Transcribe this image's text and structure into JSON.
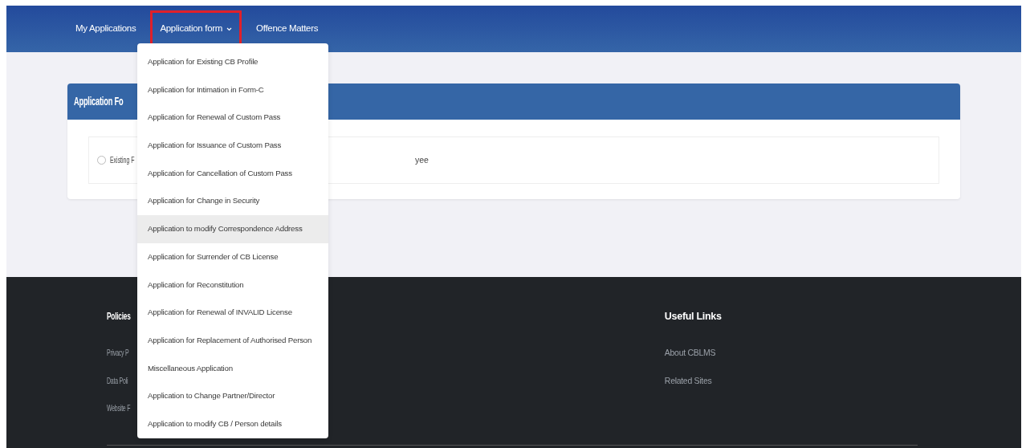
{
  "nav": {
    "items": [
      {
        "label": "My Applications",
        "kind": "link",
        "annotated": false
      },
      {
        "label": "Application form",
        "kind": "dropdown",
        "annotated": true,
        "expanded": true
      },
      {
        "label": "Offence Matters",
        "kind": "link",
        "annotated": false
      }
    ]
  },
  "dropdown_menu": {
    "items": [
      {
        "label": "Application for Existing CB Profile",
        "highlighted": false
      },
      {
        "label": "Application for Intimation in Form-C",
        "highlighted": false
      },
      {
        "label": "Application for Renewal of Custom Pass",
        "highlighted": false
      },
      {
        "label": "Application for Issuance of Custom Pass",
        "highlighted": false
      },
      {
        "label": "Application for Cancellation of Custom Pass",
        "highlighted": false
      },
      {
        "label": "Application for Change in Security",
        "highlighted": false
      },
      {
        "label": "Application to modify Correspondence Address",
        "highlighted": true
      },
      {
        "label": "Application for Surrender of CB License",
        "highlighted": false
      },
      {
        "label": "Application for Reconstitution",
        "highlighted": false
      },
      {
        "label": "Application for Renewal of INVALID License",
        "highlighted": false
      },
      {
        "label": "Application for Replacement of Authorised Person",
        "highlighted": false
      },
      {
        "label": "Miscellaneous Application",
        "highlighted": false
      },
      {
        "label": "Application to Change Partner/Director",
        "highlighted": false
      },
      {
        "label": "Application to modify CB / Person details",
        "highlighted": false
      }
    ]
  },
  "card": {
    "title": "Application Fo",
    "options": [
      {
        "label": "Existing F",
        "selected": false
      }
    ],
    "trailing_text": "yee"
  },
  "footer": {
    "columns": [
      {
        "heading": "Policies",
        "links": [
          "Privacy P",
          "Data Poli",
          "Website F"
        ]
      },
      {
        "heading": "Useful Links",
        "links": [
          "About CBLMS",
          "Related Sites"
        ]
      }
    ]
  }
}
